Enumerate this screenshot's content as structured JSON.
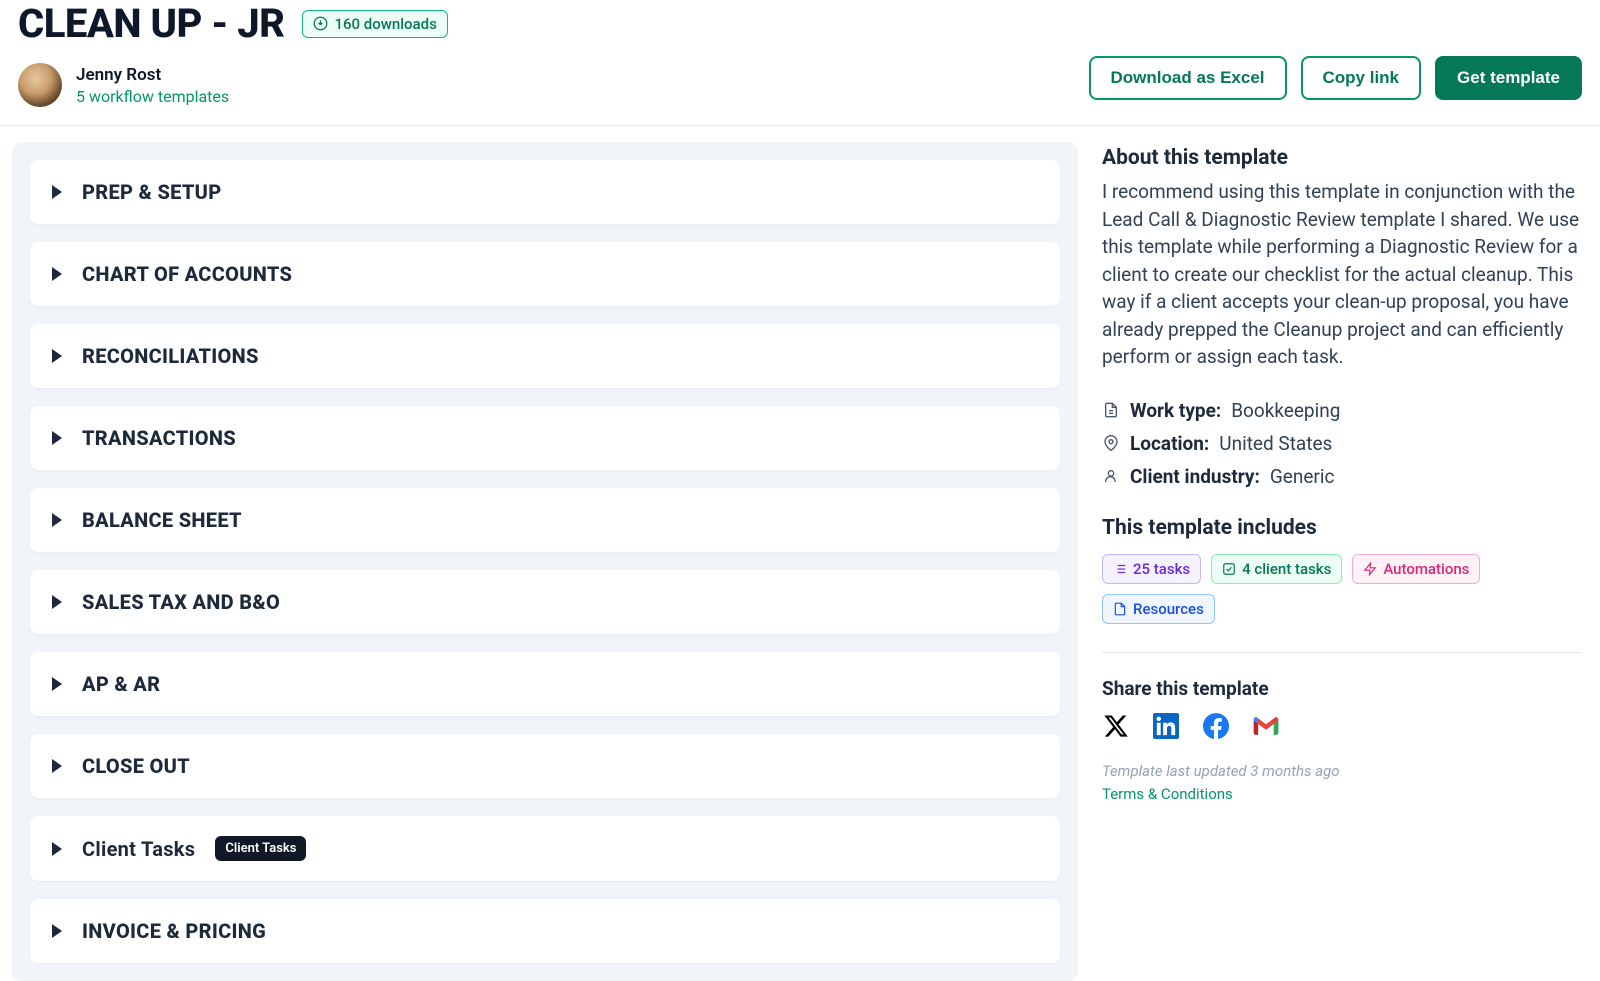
{
  "template": {
    "title": "CLEAN UP - JR",
    "downloads_badge": "160 downloads"
  },
  "author": {
    "name": "Jenny Rost",
    "sub": "5 workflow templates"
  },
  "actions": {
    "download_excel": "Download as Excel",
    "copy_link": "Copy link",
    "get_template": "Get template"
  },
  "sections": [
    {
      "label": "PREP & SETUP"
    },
    {
      "label": "CHART OF ACCOUNTS"
    },
    {
      "label": "RECONCILIATIONS"
    },
    {
      "label": "TRANSACTIONS"
    },
    {
      "label": "BALANCE SHEET"
    },
    {
      "label": "SALES TAX AND B&O"
    },
    {
      "label": "AP & AR"
    },
    {
      "label": "CLOSE OUT"
    },
    {
      "label": "Client Tasks",
      "pill": "Client Tasks"
    },
    {
      "label": "INVOICE & PRICING"
    }
  ],
  "about": {
    "heading": "About this template",
    "body": "I recommend using this template in conjunction with the Lead Call & Diagnostic Review template I shared. We use this template while performing a Diagnostic Review for a client to create our checklist for the actual cleanup. This way if a client accepts your clean-up proposal, you have already prepped the Cleanup project and can efficiently perform or assign each task."
  },
  "meta": {
    "work_type_label": "Work type:",
    "work_type_value": "Bookkeeping",
    "location_label": "Location:",
    "location_value": "United States",
    "industry_label": "Client industry:",
    "industry_value": "Generic"
  },
  "includes": {
    "heading": "This template includes",
    "badges": {
      "tasks": "25 tasks",
      "client_tasks": "4 client tasks",
      "automations": "Automations",
      "resources": "Resources"
    }
  },
  "share": {
    "heading": "Share this template"
  },
  "footer": {
    "updated": "Template last updated 3 months ago",
    "terms": "Terms & Conditions"
  }
}
